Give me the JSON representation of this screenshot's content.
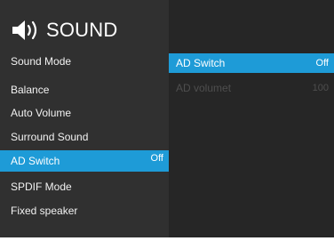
{
  "header": {
    "icon": "speaker-volume-icon",
    "title": "SOUND"
  },
  "menu": {
    "items": [
      {
        "label": "Sound Mode",
        "value": ""
      },
      {
        "label": "Balance",
        "value": ""
      },
      {
        "label": "Auto Volume",
        "value": ""
      },
      {
        "label": "Surround Sound",
        "value": ""
      },
      {
        "label": "AD Switch",
        "value": "Off",
        "selected": true
      },
      {
        "label": "SPDIF Mode",
        "value": ""
      },
      {
        "label": "Fixed speaker",
        "value": ""
      }
    ]
  },
  "submenu": {
    "items": [
      {
        "label": "AD Switch",
        "value": "Off",
        "state": "selected"
      },
      {
        "label": "AD volumet",
        "value": "100",
        "state": "disabled"
      }
    ]
  },
  "colors": {
    "menu_bg": "#303030",
    "submenu_bg": "#262626",
    "highlight": "#1e9bd7",
    "disabled_text": "#4e4e4e"
  }
}
